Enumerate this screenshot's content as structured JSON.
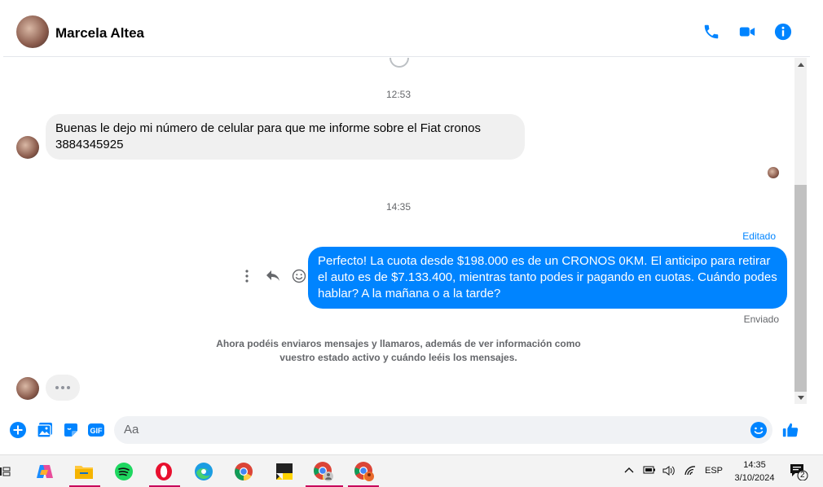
{
  "header": {
    "contact_name": "Marcela Altea",
    "accent": "#0084ff"
  },
  "conversation": {
    "time_1": "12:53",
    "incoming_message": "Buenas le dejo mi número de celular para que me informe sobre el Fiat cronos 3884345925",
    "time_2": "14:35",
    "edited_label": "Editado",
    "outgoing_message": "Perfecto! La cuota desde $198.000 es de un CRONOS 0KM. El anticipo para retirar el auto es de $7.133.400, mientras tanto podes ir pagando en cuotas. Cuándo podes hablar? A la mañana o a la tarde?",
    "sent_label": "Enviado",
    "notice": "Ahora podéis enviaros mensajes y llamaros, además de ver información como vuestro estado activo y cuándo leéis los mensajes."
  },
  "composer": {
    "placeholder": "Aa"
  },
  "taskbar": {
    "language": "ESP",
    "time": "14:35",
    "date": "3/10/2024",
    "notification_count": "2"
  }
}
